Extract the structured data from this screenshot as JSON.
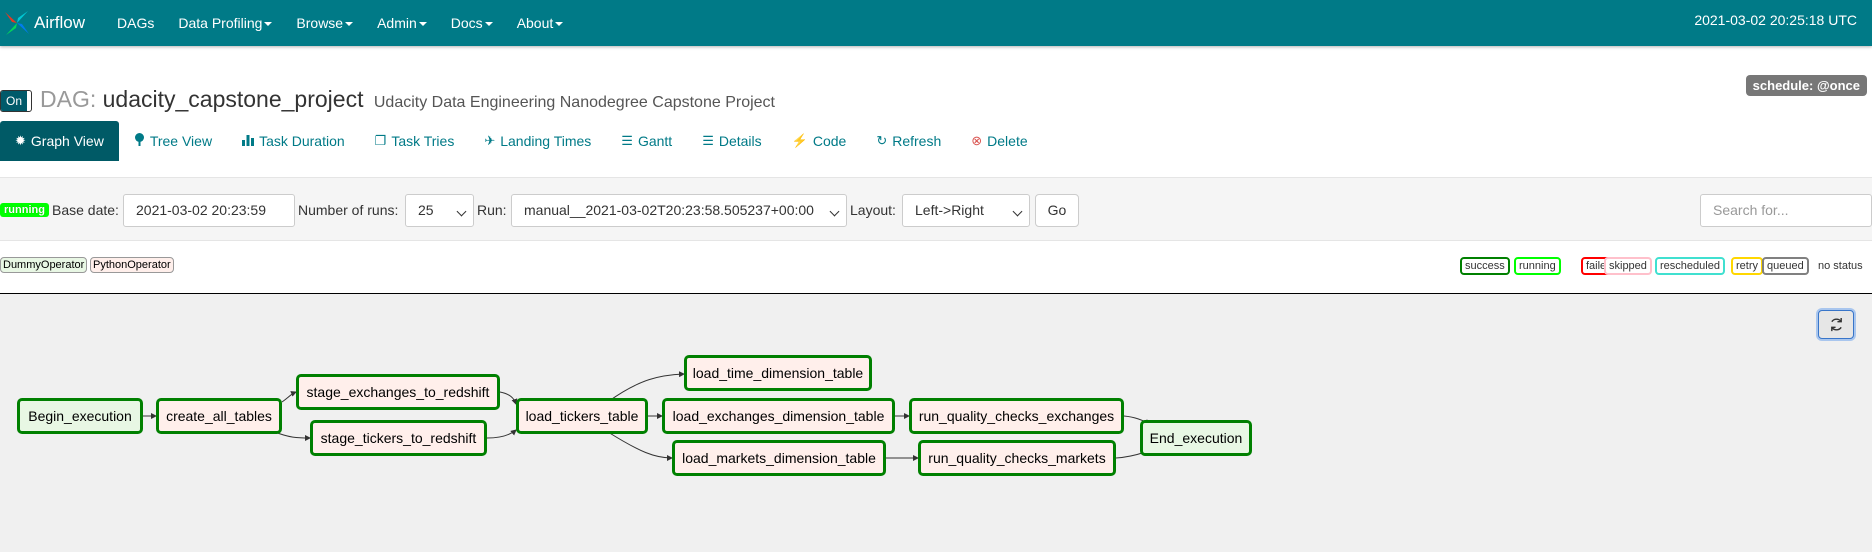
{
  "nav": {
    "brand": "Airflow",
    "items": [
      {
        "label": "DAGs",
        "dropdown": false
      },
      {
        "label": "Data Profiling",
        "dropdown": true
      },
      {
        "label": "Browse",
        "dropdown": true
      },
      {
        "label": "Admin",
        "dropdown": true
      },
      {
        "label": "Docs",
        "dropdown": true
      },
      {
        "label": "About",
        "dropdown": true
      }
    ],
    "clock": "2021-03-02 20:25:18 UTC"
  },
  "dag": {
    "toggle": "On",
    "label": "DAG:",
    "id": "udacity_capstone_project",
    "description": "Udacity Data Engineering Nanodegree Capstone Project",
    "schedule": "schedule: @once"
  },
  "tabs": [
    {
      "label": "Graph View",
      "icon": "gear-icon",
      "glyph": "✹"
    },
    {
      "label": "Tree View",
      "icon": "tree-icon",
      "glyph": "⬤"
    },
    {
      "label": "Task Duration",
      "icon": "bar-chart-icon",
      "glyph": "▮"
    },
    {
      "label": "Task Tries",
      "icon": "copy-icon",
      "glyph": "❐"
    },
    {
      "label": "Landing Times",
      "icon": "plane-icon",
      "glyph": "✈"
    },
    {
      "label": "Gantt",
      "icon": "gantt-icon",
      "glyph": "☰"
    },
    {
      "label": "Details",
      "icon": "list-icon",
      "glyph": "☰"
    },
    {
      "label": "Code",
      "icon": "flash-icon",
      "glyph": "⚡"
    },
    {
      "label": "Refresh",
      "icon": "refresh-icon",
      "glyph": "↻"
    },
    {
      "label": "Delete",
      "icon": "remove-circle-icon",
      "glyph": "⊗"
    }
  ],
  "controls": {
    "status": "running",
    "base_date_label": "Base date:",
    "base_date": "2021-03-02 20:23:59",
    "num_runs_label": "Number of runs:",
    "num_runs": "25",
    "run_label": "Run:",
    "run": "manual__2021-03-02T20:23:58.505237+00:00",
    "layout_label": "Layout:",
    "layout": "Left->Right",
    "go": "Go",
    "search_placeholder": "Search for..."
  },
  "operators": [
    "DummyOperator",
    "PythonOperator"
  ],
  "states": [
    {
      "label": "success",
      "color": "#008000"
    },
    {
      "label": "running",
      "color": "#00ff00"
    },
    {
      "label": "failed",
      "color": "#ff0000"
    },
    {
      "label": "skipped",
      "color": "#ffc0cb"
    },
    {
      "label": "rescheduled",
      "color": "#40e0d0"
    },
    {
      "label": "retry",
      "color": "#ffd700"
    },
    {
      "label": "queued",
      "color": "#808080"
    }
  ],
  "no_status": "no status",
  "graph": {
    "nodes": [
      {
        "id": "Begin_execution",
        "op": "dummy"
      },
      {
        "id": "create_all_tables",
        "op": "python"
      },
      {
        "id": "stage_exchanges_to_redshift",
        "op": "python"
      },
      {
        "id": "stage_tickers_to_redshift",
        "op": "python"
      },
      {
        "id": "load_tickers_table",
        "op": "python"
      },
      {
        "id": "load_time_dimension_table",
        "op": "python"
      },
      {
        "id": "load_exchanges_dimension_table",
        "op": "python"
      },
      {
        "id": "load_markets_dimension_table",
        "op": "python"
      },
      {
        "id": "run_quality_checks_exchanges",
        "op": "python"
      },
      {
        "id": "run_quality_checks_markets",
        "op": "python"
      },
      {
        "id": "End_execution",
        "op": "dummy"
      }
    ]
  }
}
